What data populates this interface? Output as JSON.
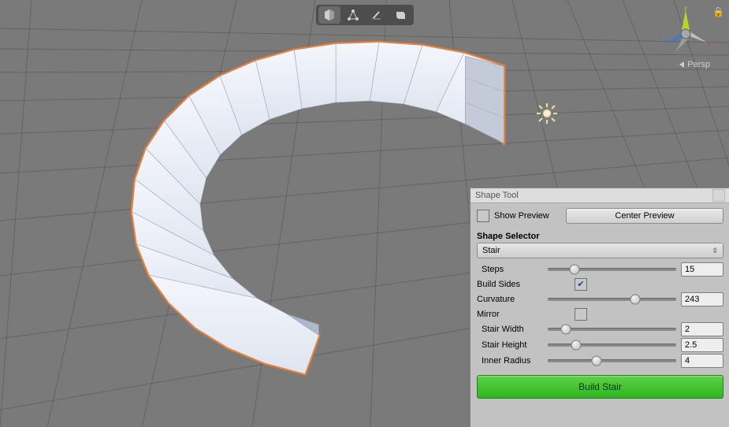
{
  "axes": {
    "y": "y",
    "x": "x",
    "z": "z"
  },
  "view_label": "Persp",
  "panel": {
    "title": "Shape Tool",
    "show_preview_label": "Show Preview",
    "show_preview_checked": false,
    "center_preview_label": "Center Preview",
    "section_title": "Shape Selector",
    "dropdown_value": "Stair",
    "fields": {
      "steps": {
        "label": "Steps",
        "value": "15",
        "min": 2,
        "max": 64,
        "pos": 0.21
      },
      "build_sides": {
        "label": "Build Sides",
        "checked": true
      },
      "curvature": {
        "label": "Curvature",
        "value": "243",
        "min": 0,
        "max": 360,
        "pos": 0.68
      },
      "mirror": {
        "label": "Mirror",
        "checked": false
      },
      "stair_width": {
        "label": "Stair Width",
        "value": "2",
        "pos": 0.14
      },
      "stair_height": {
        "label": "Stair Height",
        "value": "2.5",
        "pos": 0.22
      },
      "inner_radius": {
        "label": "Inner Radius",
        "value": "4",
        "pos": 0.38
      }
    },
    "build_label": "Build Stair"
  },
  "colors": {
    "selection": "#ff7a1a",
    "axis_y": "#b6d42a",
    "axis_x": "#d9433a",
    "axis_z": "#3b7bd6",
    "build_green": "#3cc22c"
  }
}
